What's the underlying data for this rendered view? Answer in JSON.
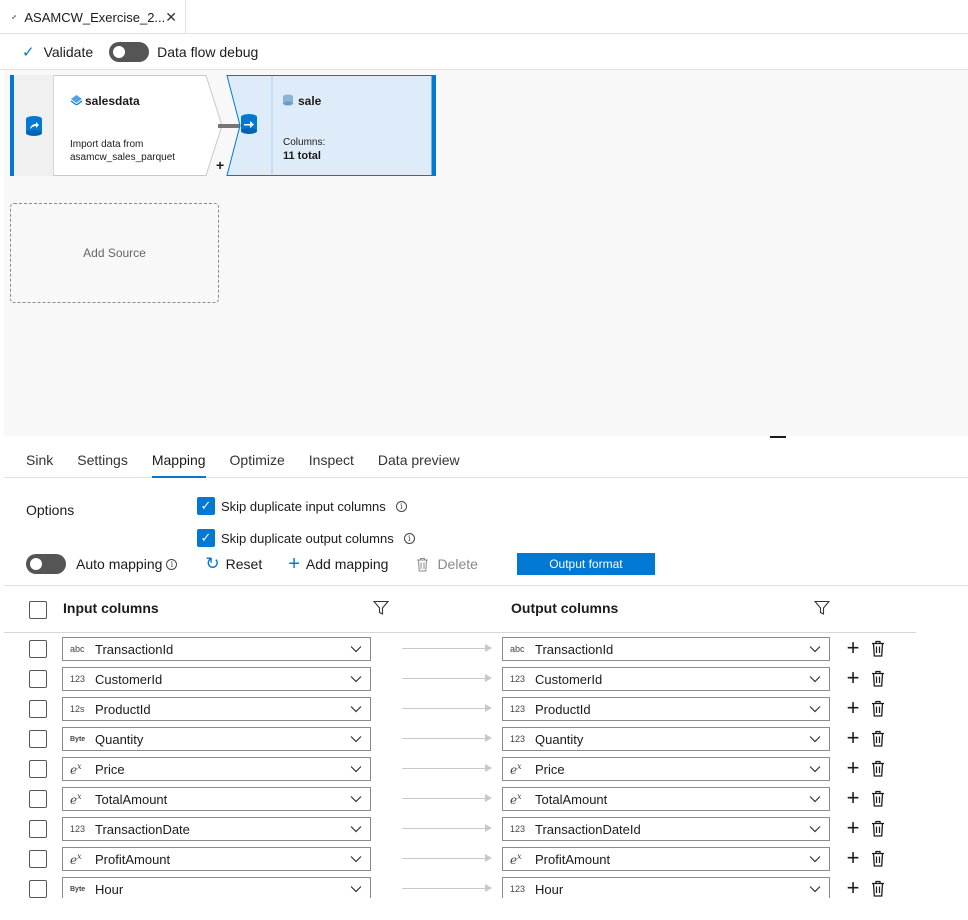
{
  "tab": {
    "title": "ASAMCW_Exercise_2...",
    "close_icon": "close-icon"
  },
  "toolbar": {
    "validate_label": "Validate",
    "debug_label": "Data flow debug",
    "debug_on": false
  },
  "canvas": {
    "source_node": {
      "name": "salesdata",
      "description_line1": "Import data from",
      "description_line2": "asamcw_sales_parquet",
      "plus": "+"
    },
    "sink_node": {
      "name": "sale",
      "columns_label": "Columns:",
      "columns_value": "11 total"
    },
    "add_source_label": "Add Source"
  },
  "panel": {
    "tabs": [
      "Sink",
      "Settings",
      "Mapping",
      "Optimize",
      "Inspect",
      "Data preview"
    ],
    "active_tab": "Mapping",
    "options_label": "Options",
    "skip_input_label": "Skip duplicate input columns",
    "skip_output_label": "Skip duplicate output columns",
    "auto_mapping_label": "Auto mapping",
    "reset_label": "Reset",
    "add_mapping_label": "Add mapping",
    "delete_label": "Delete",
    "output_format_label": "Output format"
  },
  "grid": {
    "input_header": "Input columns",
    "output_header": "Output columns",
    "rows": [
      {
        "in_type": "abc",
        "in": "TransactionId",
        "out_type": "abc",
        "out": "TransactionId"
      },
      {
        "in_type": "123",
        "in": "CustomerId",
        "out_type": "123",
        "out": "CustomerId"
      },
      {
        "in_type": "12s",
        "in": "ProductId",
        "out_type": "123",
        "out": "ProductId"
      },
      {
        "in_type": "Byte",
        "in": "Quantity",
        "out_type": "123",
        "out": "Quantity"
      },
      {
        "in_type": "ex",
        "in": "Price",
        "out_type": "ex",
        "out": "Price"
      },
      {
        "in_type": "ex",
        "in": "TotalAmount",
        "out_type": "ex",
        "out": "TotalAmount"
      },
      {
        "in_type": "123",
        "in": "TransactionDate",
        "out_type": "123",
        "out": "TransactionDateId"
      },
      {
        "in_type": "ex",
        "in": "ProfitAmount",
        "out_type": "ex",
        "out": "ProfitAmount"
      },
      {
        "in_type": "Byte",
        "in": "Hour",
        "out_type": "123",
        "out": "Hour"
      }
    ]
  },
  "colors": {
    "accent": "#0078d4",
    "node_selected_bg": "#deecf9",
    "canvas_bg": "#f8f8f8"
  }
}
